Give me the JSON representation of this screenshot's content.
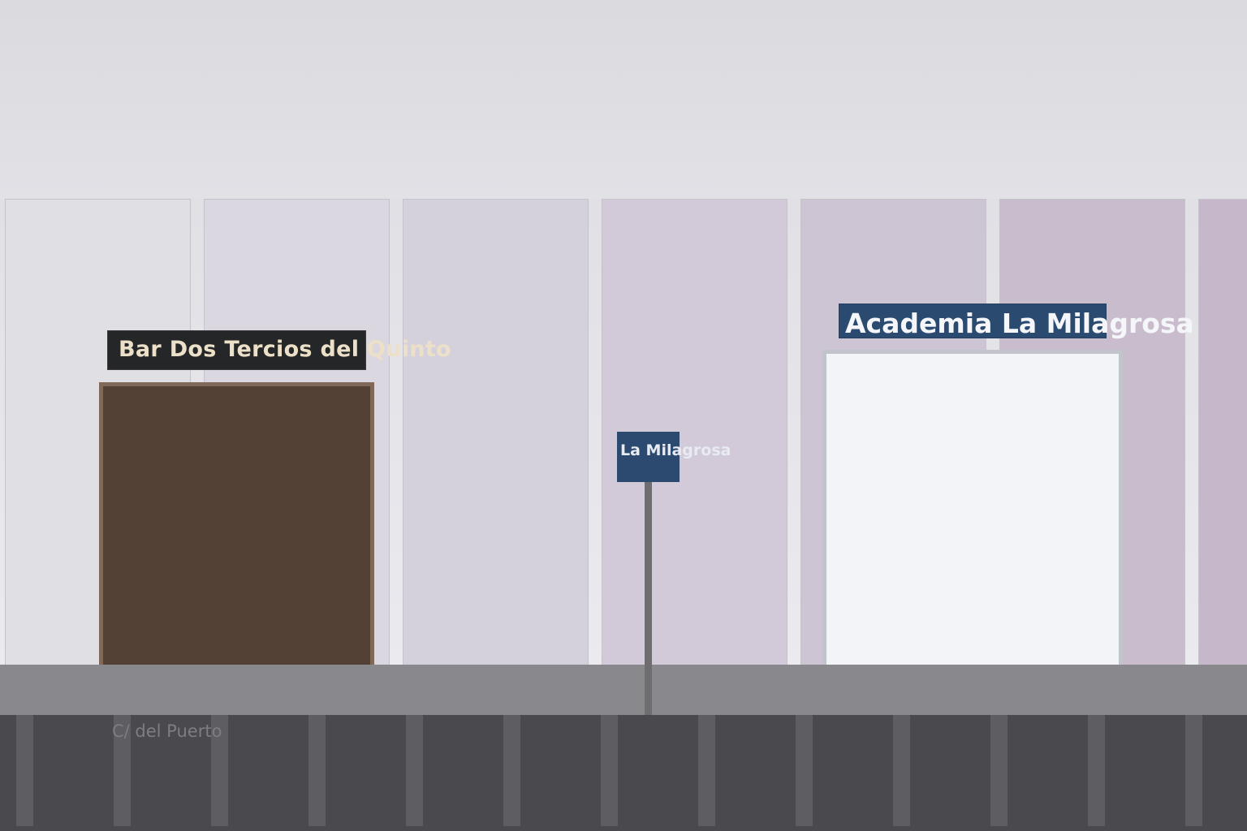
{
  "scene": {
    "bar_sign": "Bar Dos Tercios del Quinto",
    "academia_sign": "Academia La Milagrosa",
    "street_sign": "La Milagrosa",
    "street_name": "C/ del Puerto"
  },
  "colors": {
    "bar_sign_background": "#252628",
    "bar_sign_text": "#ece1c8",
    "bar_door": "#534135",
    "academia_sign_background": "#2b4a70",
    "street_sign_background": "#2c4a70",
    "sidewalk": "#88888d",
    "road": "#4a4a4e",
    "panel_tints": [
      "#e0dfe4",
      "#dad7e0",
      "#d5d1dc",
      "#d2cad8",
      "#cec5d4",
      "#c9bccd",
      "#c6b7ca"
    ]
  }
}
